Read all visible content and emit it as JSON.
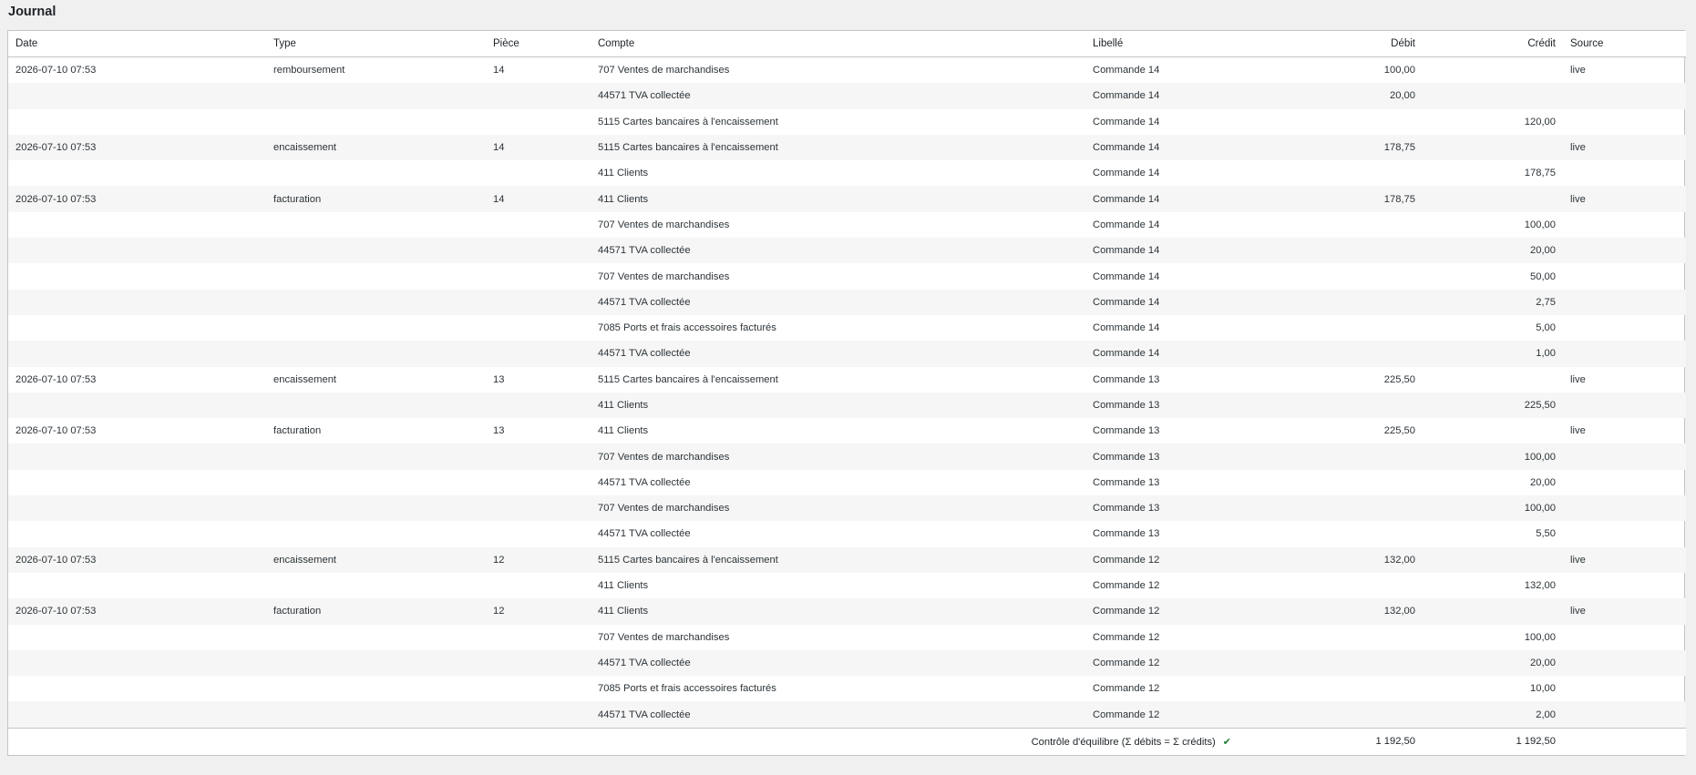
{
  "page": {
    "title": "Journal"
  },
  "columns": {
    "date": "Date",
    "type": "Type",
    "piece": "Pièce",
    "compte": "Compte",
    "libelle": "Libellé",
    "debit": "Débit",
    "credit": "Crédit",
    "source": "Source"
  },
  "rows": [
    {
      "date": "2026-07-10 07:53",
      "type": "remboursement",
      "piece": "14",
      "compte": "707 Ventes de marchandises",
      "libelle": "Commande 14",
      "debit": "100,00",
      "credit": "",
      "source": "live"
    },
    {
      "date": "",
      "type": "",
      "piece": "",
      "compte": "44571 TVA collectée",
      "libelle": "Commande 14",
      "debit": "20,00",
      "credit": "",
      "source": ""
    },
    {
      "date": "",
      "type": "",
      "piece": "",
      "compte": "5115 Cartes bancaires à l'encaissement",
      "libelle": "Commande 14",
      "debit": "",
      "credit": "120,00",
      "source": ""
    },
    {
      "date": "2026-07-10 07:53",
      "type": "encaissement",
      "piece": "14",
      "compte": "5115 Cartes bancaires à l'encaissement",
      "libelle": "Commande 14",
      "debit": "178,75",
      "credit": "",
      "source": "live"
    },
    {
      "date": "",
      "type": "",
      "piece": "",
      "compte": "411 Clients",
      "libelle": "Commande 14",
      "debit": "",
      "credit": "178,75",
      "source": ""
    },
    {
      "date": "2026-07-10 07:53",
      "type": "facturation",
      "piece": "14",
      "compte": "411 Clients",
      "libelle": "Commande 14",
      "debit": "178,75",
      "credit": "",
      "source": "live"
    },
    {
      "date": "",
      "type": "",
      "piece": "",
      "compte": "707 Ventes de marchandises",
      "libelle": "Commande 14",
      "debit": "",
      "credit": "100,00",
      "source": ""
    },
    {
      "date": "",
      "type": "",
      "piece": "",
      "compte": "44571 TVA collectée",
      "libelle": "Commande 14",
      "debit": "",
      "credit": "20,00",
      "source": ""
    },
    {
      "date": "",
      "type": "",
      "piece": "",
      "compte": "707 Ventes de marchandises",
      "libelle": "Commande 14",
      "debit": "",
      "credit": "50,00",
      "source": ""
    },
    {
      "date": "",
      "type": "",
      "piece": "",
      "compte": "44571 TVA collectée",
      "libelle": "Commande 14",
      "debit": "",
      "credit": "2,75",
      "source": ""
    },
    {
      "date": "",
      "type": "",
      "piece": "",
      "compte": "7085 Ports et frais accessoires facturés",
      "libelle": "Commande 14",
      "debit": "",
      "credit": "5,00",
      "source": ""
    },
    {
      "date": "",
      "type": "",
      "piece": "",
      "compte": "44571 TVA collectée",
      "libelle": "Commande 14",
      "debit": "",
      "credit": "1,00",
      "source": ""
    },
    {
      "date": "2026-07-10 07:53",
      "type": "encaissement",
      "piece": "13",
      "compte": "5115 Cartes bancaires à l'encaissement",
      "libelle": "Commande 13",
      "debit": "225,50",
      "credit": "",
      "source": "live"
    },
    {
      "date": "",
      "type": "",
      "piece": "",
      "compte": "411 Clients",
      "libelle": "Commande 13",
      "debit": "",
      "credit": "225,50",
      "source": ""
    },
    {
      "date": "2026-07-10 07:53",
      "type": "facturation",
      "piece": "13",
      "compte": "411 Clients",
      "libelle": "Commande 13",
      "debit": "225,50",
      "credit": "",
      "source": "live"
    },
    {
      "date": "",
      "type": "",
      "piece": "",
      "compte": "707 Ventes de marchandises",
      "libelle": "Commande 13",
      "debit": "",
      "credit": "100,00",
      "source": ""
    },
    {
      "date": "",
      "type": "",
      "piece": "",
      "compte": "44571 TVA collectée",
      "libelle": "Commande 13",
      "debit": "",
      "credit": "20,00",
      "source": ""
    },
    {
      "date": "",
      "type": "",
      "piece": "",
      "compte": "707 Ventes de marchandises",
      "libelle": "Commande 13",
      "debit": "",
      "credit": "100,00",
      "source": ""
    },
    {
      "date": "",
      "type": "",
      "piece": "",
      "compte": "44571 TVA collectée",
      "libelle": "Commande 13",
      "debit": "",
      "credit": "5,50",
      "source": ""
    },
    {
      "date": "2026-07-10 07:53",
      "type": "encaissement",
      "piece": "12",
      "compte": "5115 Cartes bancaires à l'encaissement",
      "libelle": "Commande 12",
      "debit": "132,00",
      "credit": "",
      "source": "live"
    },
    {
      "date": "",
      "type": "",
      "piece": "",
      "compte": "411 Clients",
      "libelle": "Commande 12",
      "debit": "",
      "credit": "132,00",
      "source": ""
    },
    {
      "date": "2026-07-10 07:53",
      "type": "facturation",
      "piece": "12",
      "compte": "411 Clients",
      "libelle": "Commande 12",
      "debit": "132,00",
      "credit": "",
      "source": "live"
    },
    {
      "date": "",
      "type": "",
      "piece": "",
      "compte": "707 Ventes de marchandises",
      "libelle": "Commande 12",
      "debit": "",
      "credit": "100,00",
      "source": ""
    },
    {
      "date": "",
      "type": "",
      "piece": "",
      "compte": "44571 TVA collectée",
      "libelle": "Commande 12",
      "debit": "",
      "credit": "20,00",
      "source": ""
    },
    {
      "date": "",
      "type": "",
      "piece": "",
      "compte": "7085 Ports et frais accessoires facturés",
      "libelle": "Commande 12",
      "debit": "",
      "credit": "10,00",
      "source": ""
    },
    {
      "date": "",
      "type": "",
      "piece": "",
      "compte": "44571 TVA collectée",
      "libelle": "Commande 12",
      "debit": "",
      "credit": "2,00",
      "source": ""
    }
  ],
  "footer": {
    "balance_label": "Contrôle d'équilibre (Σ débits = Σ crédits)",
    "check_icon": "check-icon",
    "check_color": "#1a7f37",
    "total_debit": "1 192,50",
    "total_credit": "1 192,50"
  }
}
